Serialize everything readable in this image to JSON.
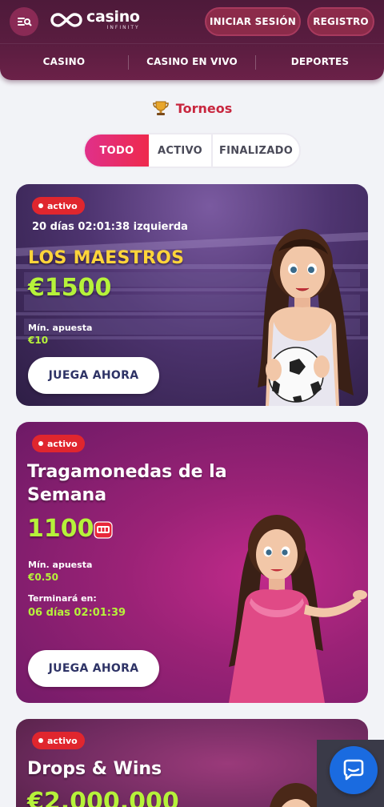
{
  "header": {
    "logo_main": "casino",
    "logo_sub": "INFINITY",
    "login_label": "INICIAR SESIÓN",
    "register_label": "REGISTRO"
  },
  "nav": {
    "items": [
      {
        "label": "CASINO"
      },
      {
        "label": "CASINO EN VIVO"
      },
      {
        "label": "DEPORTES"
      }
    ]
  },
  "page": {
    "title": "Torneos"
  },
  "tabs": [
    {
      "label": "TODO",
      "active": true
    },
    {
      "label": "ACTIVO",
      "active": false
    },
    {
      "label": "FINALIZADO",
      "active": false
    }
  ],
  "tournaments": [
    {
      "status": "activo",
      "timer": "20 días 02:01:38 izquierda",
      "title": "LOS MAESTROS",
      "prize": "€1500",
      "min_bet_label": "Mín. apuesta",
      "min_bet_value": "€10",
      "cta": "JUEGA AHORA"
    },
    {
      "status": "activo",
      "title": "Tragamonedas de la Semana",
      "prize": "1100",
      "min_bet_label": "Mín. apuesta",
      "min_bet_value": "€0.50",
      "ends_label": "Terminará en:",
      "ends_value": "06 días 02:01:39",
      "cta": "JUEGA AHORA"
    },
    {
      "status": "activo",
      "title": "Drops & Wins",
      "prize": "€2,000,000"
    }
  ],
  "colors": {
    "header_bg": "#5a1d40",
    "accent_red": "#c8273f",
    "prize_green": "#b6f23a",
    "title_gold": "#ffd43a",
    "chat_blue": "#1a6be0"
  }
}
